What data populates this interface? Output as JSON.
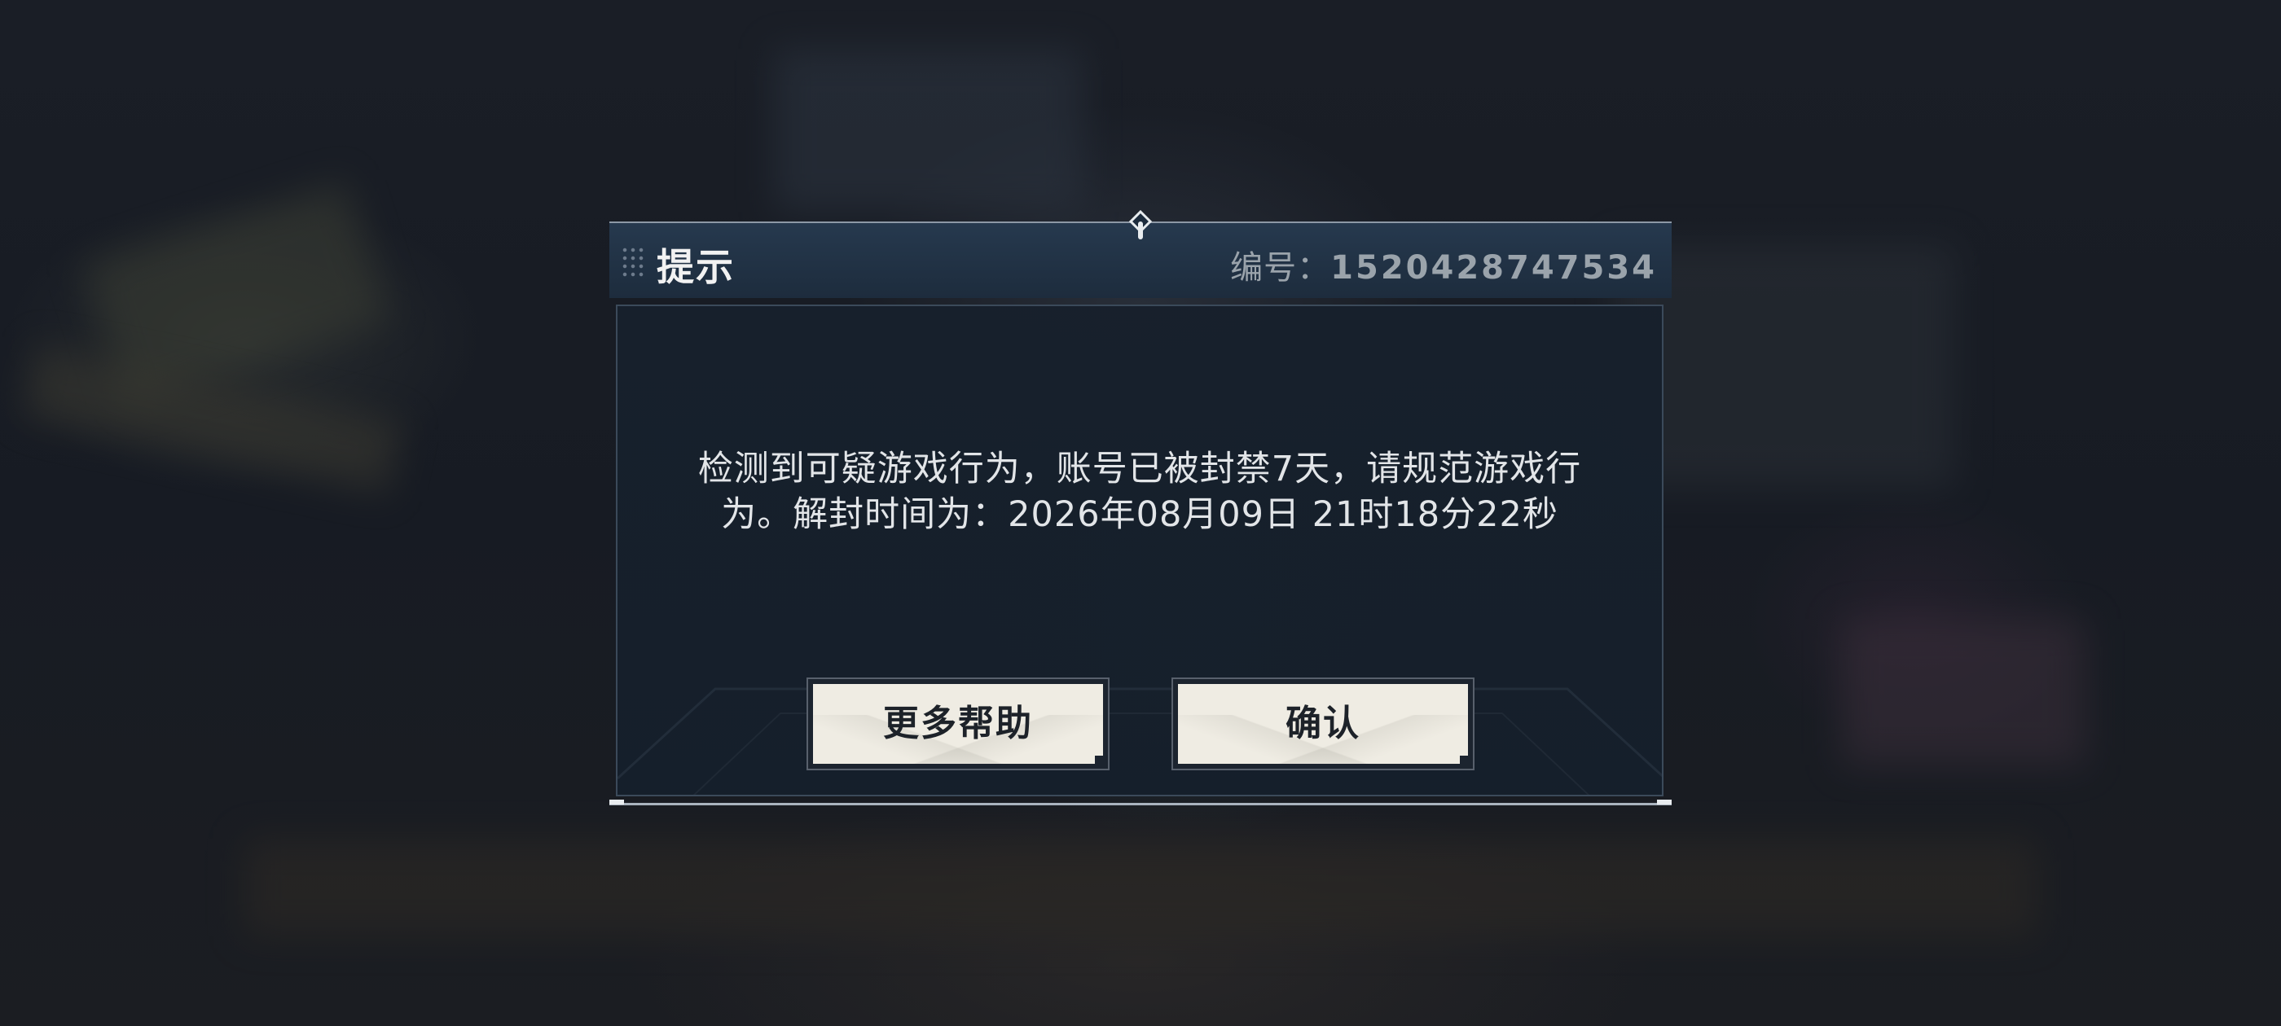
{
  "dialog": {
    "title": "提示",
    "serial_label": "编号：",
    "serial_number": "1520428747534",
    "message_line1": "检测到可疑游戏行为，账号已被封禁7天，请规范游戏行",
    "message_line2": "为。解封时间为：2026年08月09日 21时18分22秒",
    "help_button": "更多帮助",
    "confirm_button": "确认"
  },
  "icons": {
    "header_grip": "grip-dots-icon",
    "top_pin": "pin-marker-icon"
  },
  "colors": {
    "header_bg": "#26394e",
    "panel_bg": "#17202c",
    "button_bg": "#efece3",
    "button_text": "#1d2229",
    "text": "#e2e5e8",
    "serial_text": "#9aa3ab"
  }
}
